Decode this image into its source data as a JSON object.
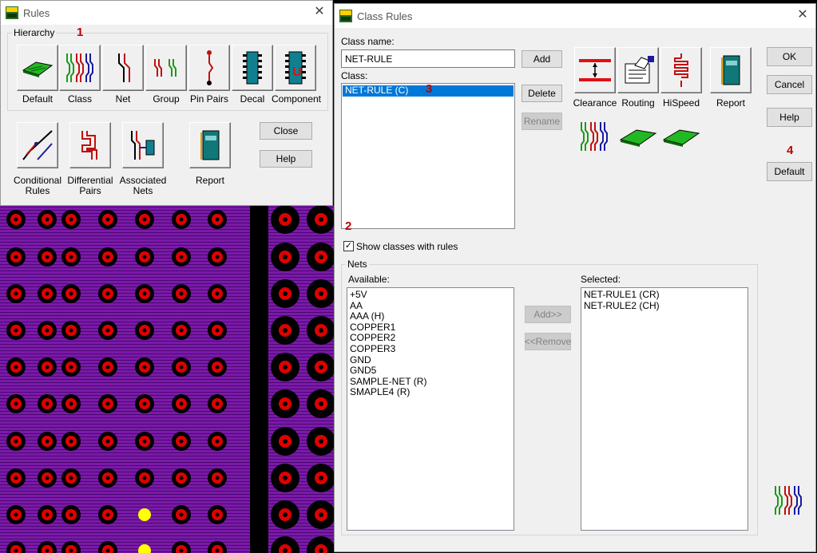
{
  "colors": {
    "pcb_purple": "#7a1aa8",
    "pad_red": "#e00000",
    "via_yellow": "#ffff00",
    "selection_blue": "#0078d7",
    "marker_red": "#c00000"
  },
  "rules_window": {
    "title": "Rules",
    "close_glyph": "✕",
    "hierarchy_label": "Hierarchy",
    "marker": "1",
    "hierarchy_items": [
      {
        "label": "Default",
        "icon": "board-icon"
      },
      {
        "label": "Class",
        "icon": "class-nets-icon"
      },
      {
        "label": "Net",
        "icon": "net-icon"
      },
      {
        "label": "Group",
        "icon": "group-icon"
      },
      {
        "label": "Pin Pairs",
        "icon": "pin-pairs-icon"
      },
      {
        "label": "Decal",
        "icon": "decal-icon"
      },
      {
        "label": "Component",
        "icon": "component-icon"
      }
    ],
    "other_items": [
      {
        "label": "Conditional\nRules",
        "icon": "conditional-rules-icon"
      },
      {
        "label": "Differential\nPairs",
        "icon": "differential-pairs-icon"
      },
      {
        "label": "Associated\nNets",
        "icon": "associated-nets-icon"
      },
      {
        "label": "Report",
        "icon": "report-icon"
      }
    ],
    "close_label": "Close",
    "help_label": "Help"
  },
  "class_rules_window": {
    "title": "Class Rules",
    "close_glyph": "✕",
    "class_name_label": "Class name:",
    "class_name_value": "NET-RULE",
    "class_label": "Class:",
    "class_items": [
      "NET-RULE  (C)"
    ],
    "marker_2": "2",
    "marker_3": "3",
    "marker_4": "4",
    "add_label": "Add",
    "delete_label": "Delete",
    "rename_label": "Rename",
    "rule_buttons": [
      {
        "label": "Clearance",
        "icon": "clearance-icon"
      },
      {
        "label": "Routing",
        "icon": "routing-icon"
      },
      {
        "label": "HiSpeed",
        "icon": "hispeed-icon"
      },
      {
        "label": "Report",
        "icon": "report-icon"
      }
    ],
    "ok_label": "OK",
    "cancel_label": "Cancel",
    "help_label": "Help",
    "default_label": "Default",
    "show_classes_label": "Show classes with rules",
    "show_classes_checked": true,
    "nets_group_label": "Nets",
    "available_label": "Available:",
    "available_items": [
      "+5V",
      "AA",
      "AAA  (H)",
      "COPPER1",
      "COPPER2",
      "COPPER3",
      "GND",
      "GND5",
      "SAMPLE-NET  (R)",
      "SMAPLE4  (R)"
    ],
    "selected_label": "Selected:",
    "selected_items": [
      "NET-RULE1  (CR)",
      "NET-RULE2  (CH)"
    ],
    "add_net_label": "Add>>",
    "remove_net_label": "<<Remove"
  }
}
